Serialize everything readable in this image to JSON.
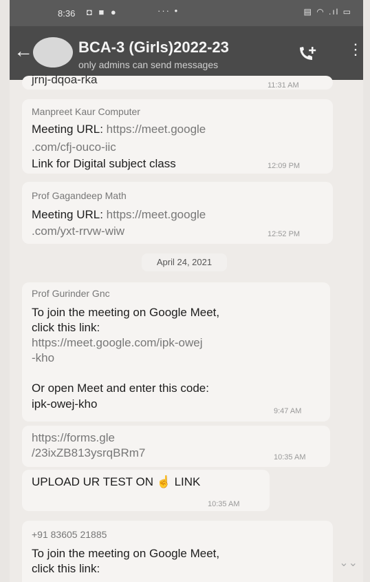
{
  "status": {
    "time": "8:36",
    "left_icons": "◘ ■ ●",
    "dots": "··· •",
    "right_icons": "▤ ◠ .ıl ▭"
  },
  "header": {
    "title": "BCA-3 (Girls)2022-23",
    "subtitle": "only admins can send messages",
    "back_glyph": "←",
    "menu_glyph": "⋮"
  },
  "messages": [
    {
      "partial_top": "jrnj-dqoa-rka",
      "time": "11:31 AM"
    },
    {
      "sender": "Manpreet Kaur Computer",
      "lines": [
        {
          "label": "Meeting URL: ",
          "link": "https://meet.google"
        },
        {
          "link": ".com/cfj-ouco-iic"
        },
        {
          "text": "Link for Digital subject class"
        }
      ],
      "time": "12:09 PM"
    },
    {
      "sender": "Prof Gagandeep Math",
      "lines": [
        {
          "label": "Meeting URL: ",
          "link": "https://meet.google"
        },
        {
          "link": ".com/yxt-rrvw-wiw"
        }
      ],
      "time": "12:52 PM"
    },
    {
      "date": "April 24, 2021"
    },
    {
      "sender": "Prof Gurinder Gnc",
      "lines": [
        "To join the meeting on Google Meet,",
        "click this link:",
        "https://meet.google.com/ipk-owej",
        "-kho",
        "Or open Meet and enter this code:",
        "ipk-owej-kho"
      ],
      "time": "9:47 AM"
    },
    {
      "lines": [
        "https://forms.gle",
        "/23ixZB813ysrqBRm7"
      ],
      "time": "10:35 AM"
    },
    {
      "text": "UPLOAD UR TEST ON ☝ LINK",
      "time": "10:35 AM"
    },
    {
      "sender": "+91 83605 21885",
      "lines": [
        "To join the meeting on Google Meet,",
        "click this link:"
      ]
    }
  ],
  "scroll_down_glyph": "⌄⌄"
}
